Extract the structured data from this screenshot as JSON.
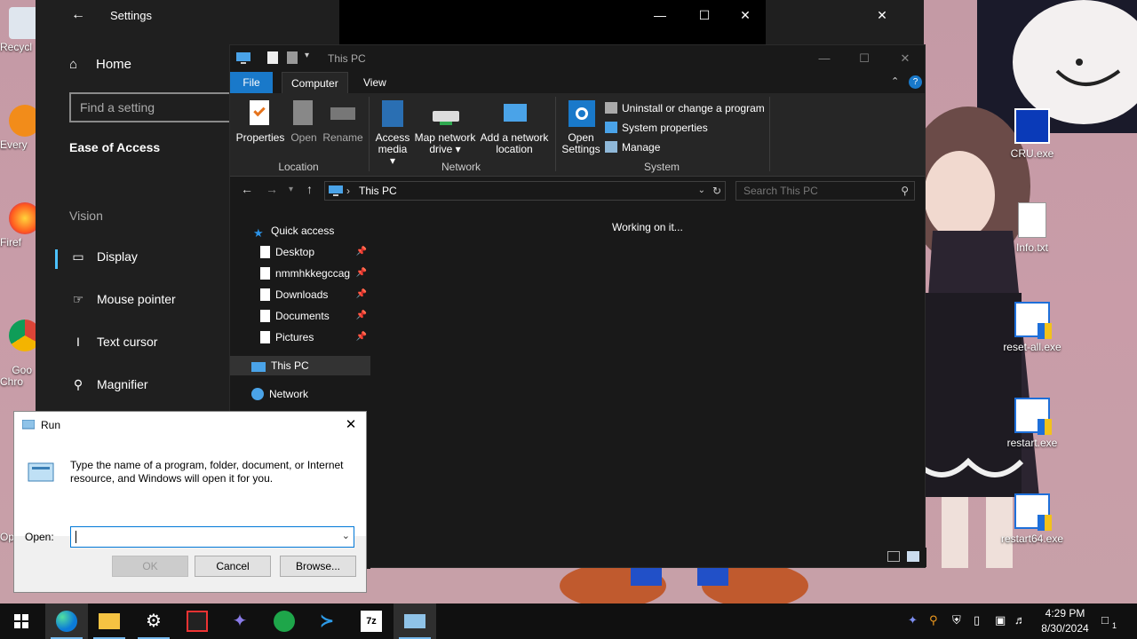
{
  "desktop": {
    "left_icons": [
      {
        "label": "Recycl"
      },
      {
        "label": "Every"
      },
      {
        "label": "Firef"
      },
      {
        "label": "Goo\nChro"
      },
      {
        "label": "Op"
      }
    ],
    "right_icons": [
      {
        "label": "CRU.exe"
      },
      {
        "label": "Info.txt"
      },
      {
        "label": "reset-all.exe"
      },
      {
        "label": "restart.exe"
      },
      {
        "label": "restart64.exe"
      }
    ]
  },
  "settings": {
    "title": "Settings",
    "home": "Home",
    "search_placeholder": "Find a setting",
    "section": "Ease of Access",
    "group": "Vision",
    "items": [
      {
        "label": "Display"
      },
      {
        "label": "Mouse pointer"
      },
      {
        "label": "Text cursor"
      },
      {
        "label": "Magnifier"
      }
    ]
  },
  "explorer": {
    "title": "This PC",
    "tabs": {
      "file": "File",
      "computer": "Computer",
      "view": "View"
    },
    "ribbon": {
      "properties": "Properties",
      "open": "Open",
      "rename": "Rename",
      "access_media_1": "Access",
      "access_media_2": "media",
      "map_drive_1": "Map network",
      "map_drive_2": "drive",
      "add_location_1": "Add a network",
      "add_location_2": "location",
      "open_settings_1": "Open",
      "open_settings_2": "Settings",
      "uninstall": "Uninstall or change a program",
      "system_properties": "System properties",
      "manage": "Manage",
      "group_location": "Location",
      "group_network": "Network",
      "group_system": "System"
    },
    "address": "This PC",
    "search_placeholder": "Search This PC",
    "nav": {
      "quick_access": "Quick access",
      "pinned": [
        {
          "label": "Desktop"
        },
        {
          "label": "nmmhkkegccag"
        },
        {
          "label": "Downloads"
        },
        {
          "label": "Documents"
        },
        {
          "label": "Pictures"
        }
      ],
      "this_pc": "This PC",
      "network": "Network"
    },
    "status_message": "Working on it..."
  },
  "run": {
    "title": "Run",
    "description": "Type the name of a program, folder, document, or Internet resource, and Windows will open it for you.",
    "open_label": "Open:",
    "open_value": "",
    "ok": "OK",
    "cancel": "Cancel",
    "browse": "Browse..."
  },
  "taskbar": {
    "time": "4:29 PM",
    "date": "8/30/2024",
    "notification_count": "1"
  }
}
